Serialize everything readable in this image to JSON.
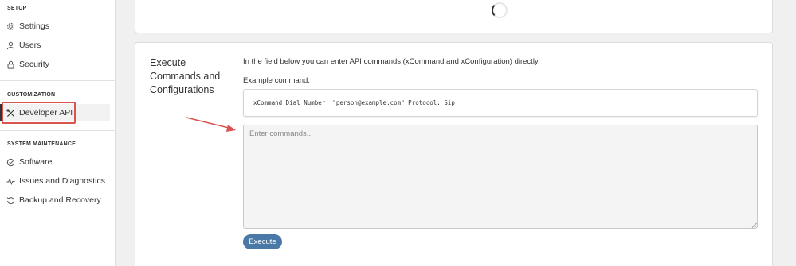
{
  "sidebar": {
    "sections": [
      {
        "heading": "SETUP",
        "items": [
          {
            "label": "Settings",
            "icon": "gear-icon"
          },
          {
            "label": "Users",
            "icon": "user-icon"
          },
          {
            "label": "Security",
            "icon": "lock-icon"
          }
        ]
      },
      {
        "heading": "CUSTOMIZATION",
        "items": [
          {
            "label": "Developer API",
            "icon": "tools-icon",
            "active": true
          }
        ]
      },
      {
        "heading": "SYSTEM MAINTENANCE",
        "items": [
          {
            "label": "Software",
            "icon": "software-check-icon"
          },
          {
            "label": "Issues and Diagnostics",
            "icon": "pulse-icon"
          },
          {
            "label": "Backup and Recovery",
            "icon": "backup-icon"
          }
        ]
      }
    ]
  },
  "main": {
    "section_title": "Execute Commands and Configurations",
    "intro": "In the field below you can enter API commands (xCommand and xConfiguration) directly.",
    "example_label": "Example command:",
    "example_command": "xCommand Dial Number: \"person@example.com\" Protocol: Sip",
    "commands_placeholder": "Enter commands...",
    "commands_value": "",
    "execute_label": "Execute"
  },
  "colors": {
    "accent": "#4a79a8",
    "highlight": "#d9534f",
    "annotation_arrow": "#d9534f"
  }
}
